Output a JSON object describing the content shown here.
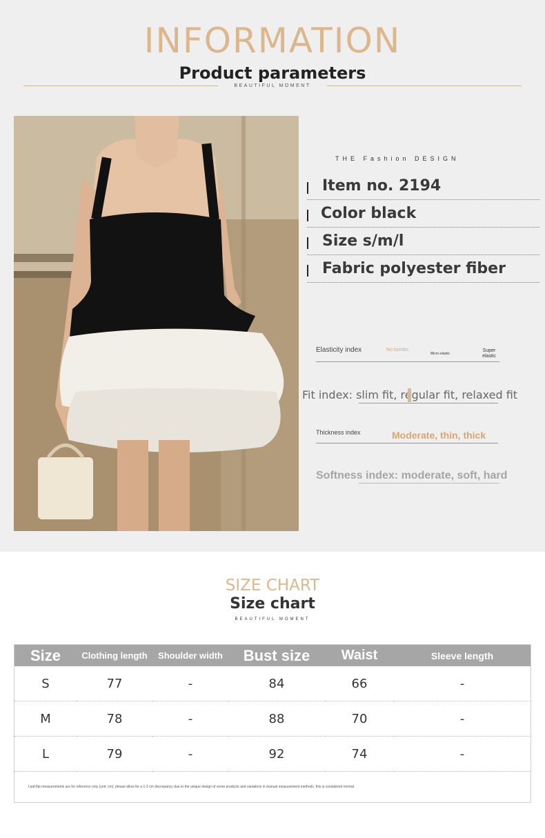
{
  "header": {
    "title": "INFORMATION",
    "subtitle": "Product parameters",
    "tagline": "BEAUTIFUL MOMENT"
  },
  "product": {
    "design_label": "THE Fashion DESIGN",
    "params": [
      {
        "label": "Item no. 2194"
      },
      {
        "label": "Color black"
      },
      {
        "label": "Size s/m/l"
      },
      {
        "label": "Fabric polyester fiber"
      }
    ]
  },
  "indices": {
    "elasticity": {
      "label": "Elasticity index",
      "options": [
        "No bombs",
        "Micro-elastic",
        "Super elastic"
      ],
      "selected": "No bombs"
    },
    "fit": {
      "text": "Fit index: slim fit, regular fit, relaxed fit",
      "selected": "regular fit"
    },
    "thickness": {
      "label": "Thickness index",
      "value": "Moderate, thin, thick"
    },
    "softness": {
      "text": "Softness index: moderate, soft, hard"
    }
  },
  "size_chart": {
    "title": "SIZE CHART",
    "subtitle": "Size chart",
    "tagline": "BEAUTIFUL MOMENT",
    "headers": [
      "Size",
      "Clothing length",
      "Shoulder width",
      "Bust size",
      "Waist",
      "Sleeve length"
    ],
    "rows": [
      [
        "S",
        "77",
        "-",
        "84",
        "66",
        "-"
      ],
      [
        "M",
        "78",
        "-",
        "88",
        "70",
        "-"
      ],
      [
        "L",
        "79",
        "-",
        "92",
        "74",
        "-"
      ]
    ],
    "note": "Laid-flat measurements are for reference only (unit: cm). please allow for a 1-3 cm discrepancy due to the unique design of some products and variations in manual measurement methods. this is considered normal."
  },
  "colors": {
    "accent_gold": "#dcb78d",
    "orange_value": "#dba56e",
    "table_header": "#a6a6a6"
  }
}
